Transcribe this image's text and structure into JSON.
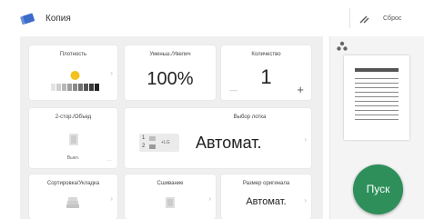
{
  "header": {
    "title": "Копия",
    "reset_label": "Сброс",
    "app_icon": "copy-stack-icon",
    "settings_icon": "pencil-icon"
  },
  "tiles": {
    "density": {
      "label": "Плотность",
      "level": 0.5
    },
    "zoom": {
      "label": "Уменьш./Увелич",
      "value": "100%"
    },
    "quantity": {
      "label": "Количество",
      "value": "1",
      "minus": "—",
      "plus": "+"
    },
    "duplex": {
      "label": "2-стор./Объед",
      "value": "Выкл."
    },
    "tray": {
      "label": "Выбор лотка",
      "value": "Автомат.",
      "tray1": "1",
      "tray2": "2",
      "plus_label": "+LG"
    },
    "sort": {
      "label": "Сортировка/Укладка"
    },
    "staple": {
      "label": "Сшивание"
    },
    "original_size": {
      "label": "Размер оригинала",
      "value": "Автомат."
    }
  },
  "side": {
    "start_label": "Пуск",
    "start_color": "#2e8f5a"
  }
}
